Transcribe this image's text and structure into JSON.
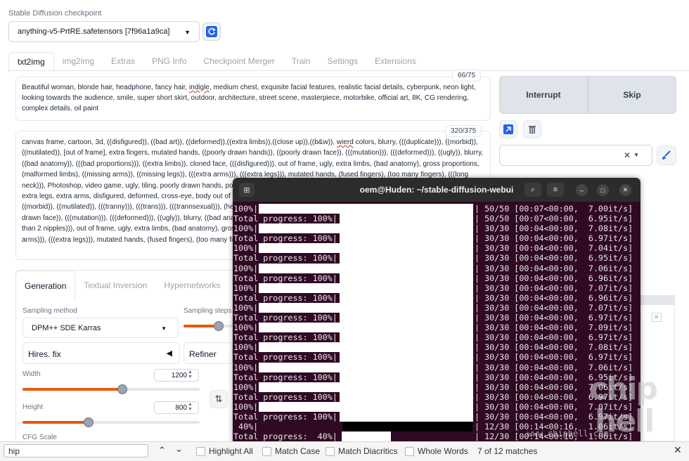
{
  "checkpoint": {
    "label": "Stable Diffusion checkpoint",
    "value": "anything-v5-PrtRE.safetensors [7f96a1a9ca]"
  },
  "tabs": [
    "txt2img",
    "img2img",
    "Extras",
    "PNG Info",
    "Checkpoint Merger",
    "Train",
    "Settings",
    "Extensions"
  ],
  "prompt": {
    "counter": "66/75",
    "text_before": "Beautiful woman, blonde hair, headphone,  fancy hair, ",
    "misspelled": "indigle",
    "text_after": ", medium chest, exquisite facial features, realistic facial details, cyberpunk, neon light,  looking towards the audience, smile, super short skirt, outdoor, architecture, street scene, masterpiece, motorbike, official art, 8K, CG rendering, complex details. oil paint"
  },
  "negative_prompt": {
    "counter": "320/375",
    "text_before": "canvas frame, cartoon, 3d, ((disfigured)), ((bad art)), ((deformed)),((extra limbs)),((close up)),((b&w)), ",
    "misspelled": "wierd",
    "text_after": " colors, blurry, (((duplicate))), ((morbid)), ((mutilated)), [out of frame], extra fingers, mutated hands, ((poorly drawn hands)), ((poorly drawn face)), (((mutation))), (((deformed))), ((ugly)), blurry, ((bad anatomy)), (((bad proportions))), ((extra limbs)), cloned face, (((disfigured))), out of frame, ugly, extra limbs, (bad anatomy), gross proportions, (malformed limbs), ((missing arms)), ((missing legs)), (((extra arms))), (((extra legs))), mutated hands, (fused fingers), (too many fingers), (((long neck))), Photoshop, video game, ugly, tiling, poorly drawn hands, poorly drawn feet, poorly drawn face, out of frame, mutation, mutated, extra limbs, extra legs, extra arms, disfigured, deformed, cross-eye, body out of frame, blurry, bad art, bad anatomy, 3d render,((((ugly)))), (((duplicate))), ((morbid)), ((mutilated)), (((tranny))), (((trans))), (((trannsexual))), (hermaphrodite), extra fingers, mutated hands, ((poorly drawn hands)), ((poorly drawn face)), (((mutation))), (((deformed))), ((ugly)), blurry, ((bad anatomy)), (((bad proportions))), ((extra limbs)), cloned face, (((disfigured))). (((more than 2 nipples))), out of frame, ugly, extra limbs, (bad anatomy), gross proportions, (malformed limbs), ((missing arms)), ((missing legs)), (((extra arms))), (((extra legs))), mutated hands, (fused fingers), (too many fingers), (((long neck)))"
  },
  "actions": {
    "interrupt": "Interrupt",
    "skip": "Skip"
  },
  "gen_tabs": [
    "Generation",
    "Textual Inversion",
    "Hypernetworks"
  ],
  "sampling": {
    "method_label": "Sampling method",
    "method_value": "DPM++ SDE Karras",
    "steps_label": "Sampling steps"
  },
  "hires": {
    "label": "Hires. fix"
  },
  "refiner": {
    "label": "Refiner"
  },
  "width": {
    "label": "Width",
    "value": "1200",
    "fraction": 0.56
  },
  "height": {
    "label": "Height",
    "value": "800",
    "fraction": 0.37
  },
  "cfg": {
    "label": "CFG Scale"
  },
  "terminal": {
    "title": "oem@Huden: ~/stable-diffusion-webui",
    "rows": [
      {
        "left": "100%",
        "bar": 1.0,
        "right": "50/50 [00:07<00:00,  7.00it/s]"
      },
      {
        "left": "Total progress: 100%",
        "bar": 1.0,
        "right": "50/50 [00:07<00:00,  6.95it/s]"
      },
      {
        "left": "100%",
        "bar": 1.0,
        "right": "30/30 [00:04<00:00,  7.08it/s]"
      },
      {
        "left": "Total progress: 100%",
        "bar": 1.0,
        "right": "30/30 [00:04<00:00,  6.97it/s]"
      },
      {
        "left": "100%",
        "bar": 1.0,
        "right": "30/30 [00:04<00:00,  7.04it/s]"
      },
      {
        "left": "Total progress: 100%",
        "bar": 1.0,
        "right": "30/30 [00:04<00:00,  6.95it/s]"
      },
      {
        "left": "100%",
        "bar": 1.0,
        "right": "30/30 [00:04<00:00,  7.06it/s]"
      },
      {
        "left": "Total progress: 100%",
        "bar": 1.0,
        "right": "30/30 [00:04<00:00,  6.96it/s]"
      },
      {
        "left": "100%",
        "bar": 1.0,
        "right": "30/30 [00:04<00:00,  7.07it/s]"
      },
      {
        "left": "Total progress: 100%",
        "bar": 1.0,
        "right": "30/30 [00:04<00:00,  6.96it/s]"
      },
      {
        "left": "100%",
        "bar": 1.0,
        "right": "30/30 [00:04<00:00,  7.07it/s]"
      },
      {
        "left": "Total progress: 100%",
        "bar": 1.0,
        "right": "30/30 [00:04<00:00,  6.97it/s]"
      },
      {
        "left": "100%",
        "bar": 1.0,
        "right": "30/30 [00:04<00:00,  7.09it/s]"
      },
      {
        "left": "Total progress: 100%",
        "bar": 1.0,
        "right": "30/30 [00:04<00:00,  6.97it/s]"
      },
      {
        "left": "100%",
        "bar": 1.0,
        "right": "30/30 [00:04<00:00,  7.08it/s]"
      },
      {
        "left": "Total progress: 100%",
        "bar": 1.0,
        "right": "30/30 [00:04<00:00,  6.97it/s]"
      },
      {
        "left": "100%",
        "bar": 1.0,
        "right": "30/30 [00:04<00:00,  7.06it/s]"
      },
      {
        "left": "Total progress: 100%",
        "bar": 1.0,
        "right": "30/30 [00:04<00:00,  6.95it/s]"
      },
      {
        "left": "100%",
        "bar": 1.0,
        "right": "30/30 [00:04<00:00,  7.06it/s]"
      },
      {
        "left": "Total progress: 100%",
        "bar": 1.0,
        "right": "30/30 [00:04<00:00,  6.97it/s]"
      },
      {
        "left": "100%",
        "bar": 1.0,
        "right": "30/30 [00:04<00:00,  7.07it/s]"
      },
      {
        "left": "Total progress: 100%",
        "bar": 1.0,
        "right": "30/30 [00:04<00:00,  6.97it/s]"
      },
      {
        "left": " 40%",
        "bar": 0.4,
        "right": "12/30 [00:14<00:16,  1.06it/s]"
      },
      {
        "left": "Total progress:  40%",
        "bar": 0.4,
        "right": "12/30 [00:14<00:16,  1.06it/s]"
      }
    ]
  },
  "find_bar": {
    "query": "hip",
    "highlight_all": "Highlight All",
    "match_case": "Match Case",
    "match_diacritics": "Match Diacritics",
    "whole_words": "Whole Words",
    "status": "7 of 12 matches"
  },
  "watermark": {
    "text": "chip hell",
    "url": "www.chiphell.com"
  },
  "colors": {
    "accent": "#e8580c",
    "terminal_bg": "#300a24",
    "blue_icon": "#2563eb"
  }
}
